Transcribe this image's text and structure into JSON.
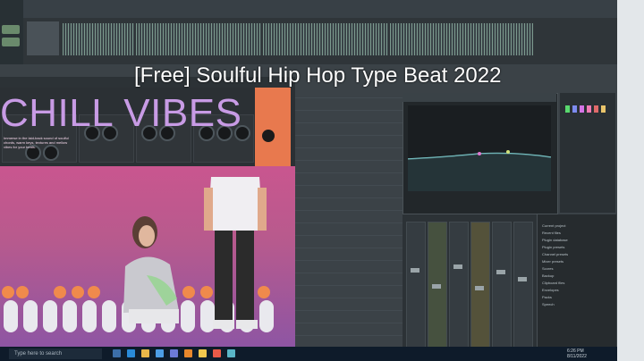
{
  "overlay_title": "[Free] Soulful Hip Hop Type Beat 2022",
  "plugin": {
    "title": "CHILL VIBES",
    "description": "Immerse in the laid-back sound of soulful chords, warm keys, textures and mellow vibes for your beats."
  },
  "taskbar": {
    "search_placeholder": "Type here to search",
    "time": "6:26 PM",
    "date": "8/11/2022"
  },
  "browser": {
    "items": [
      "Current project",
      "Recent files",
      "Plugin database",
      "Plugin presets",
      "Channel presets",
      "Mixer presets",
      "Scores",
      "Backup",
      "Clipboard files",
      "Envelopes",
      "Packs",
      "Speech"
    ]
  },
  "colors": {
    "accent": "#f08a4c",
    "vibes": "#c89be5",
    "taskbar": "#0e1b2a"
  }
}
